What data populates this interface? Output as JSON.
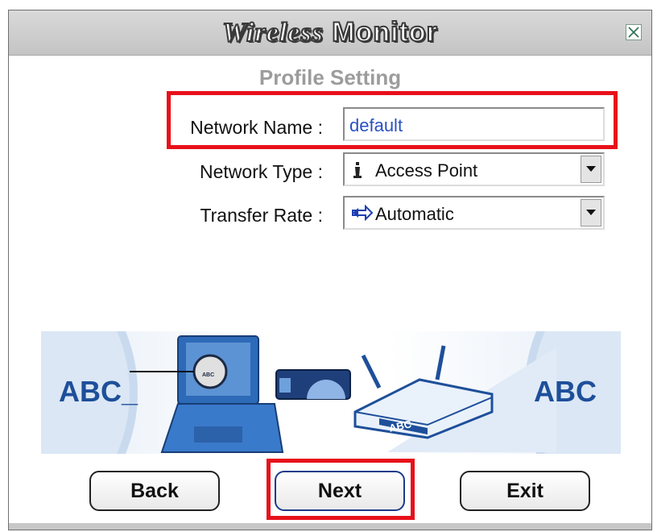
{
  "window": {
    "title_brand": "Wireless",
    "title_word": "Monitor",
    "close_glyph": "✕"
  },
  "page": {
    "subtitle": "Profile Setting"
  },
  "form": {
    "network_name": {
      "label": "Network Name :",
      "value": "default"
    },
    "network_type": {
      "label": "Network Type :",
      "value": "Access Point",
      "icon": "access-point-icon"
    },
    "transfer_rate": {
      "label": "Transfer Rate :",
      "value": "Automatic",
      "icon": "double-arrow-icon"
    }
  },
  "banner": {
    "left_text": "ABC_",
    "right_text": "ABC",
    "router_text": "ABC",
    "disc_text": "ABC"
  },
  "buttons": {
    "back": "Back",
    "next": "Next",
    "exit": "Exit"
  },
  "colors": {
    "highlight": "#e8101a",
    "field_text": "#2a4fc4",
    "banner_blue": "#1e4f9a"
  }
}
